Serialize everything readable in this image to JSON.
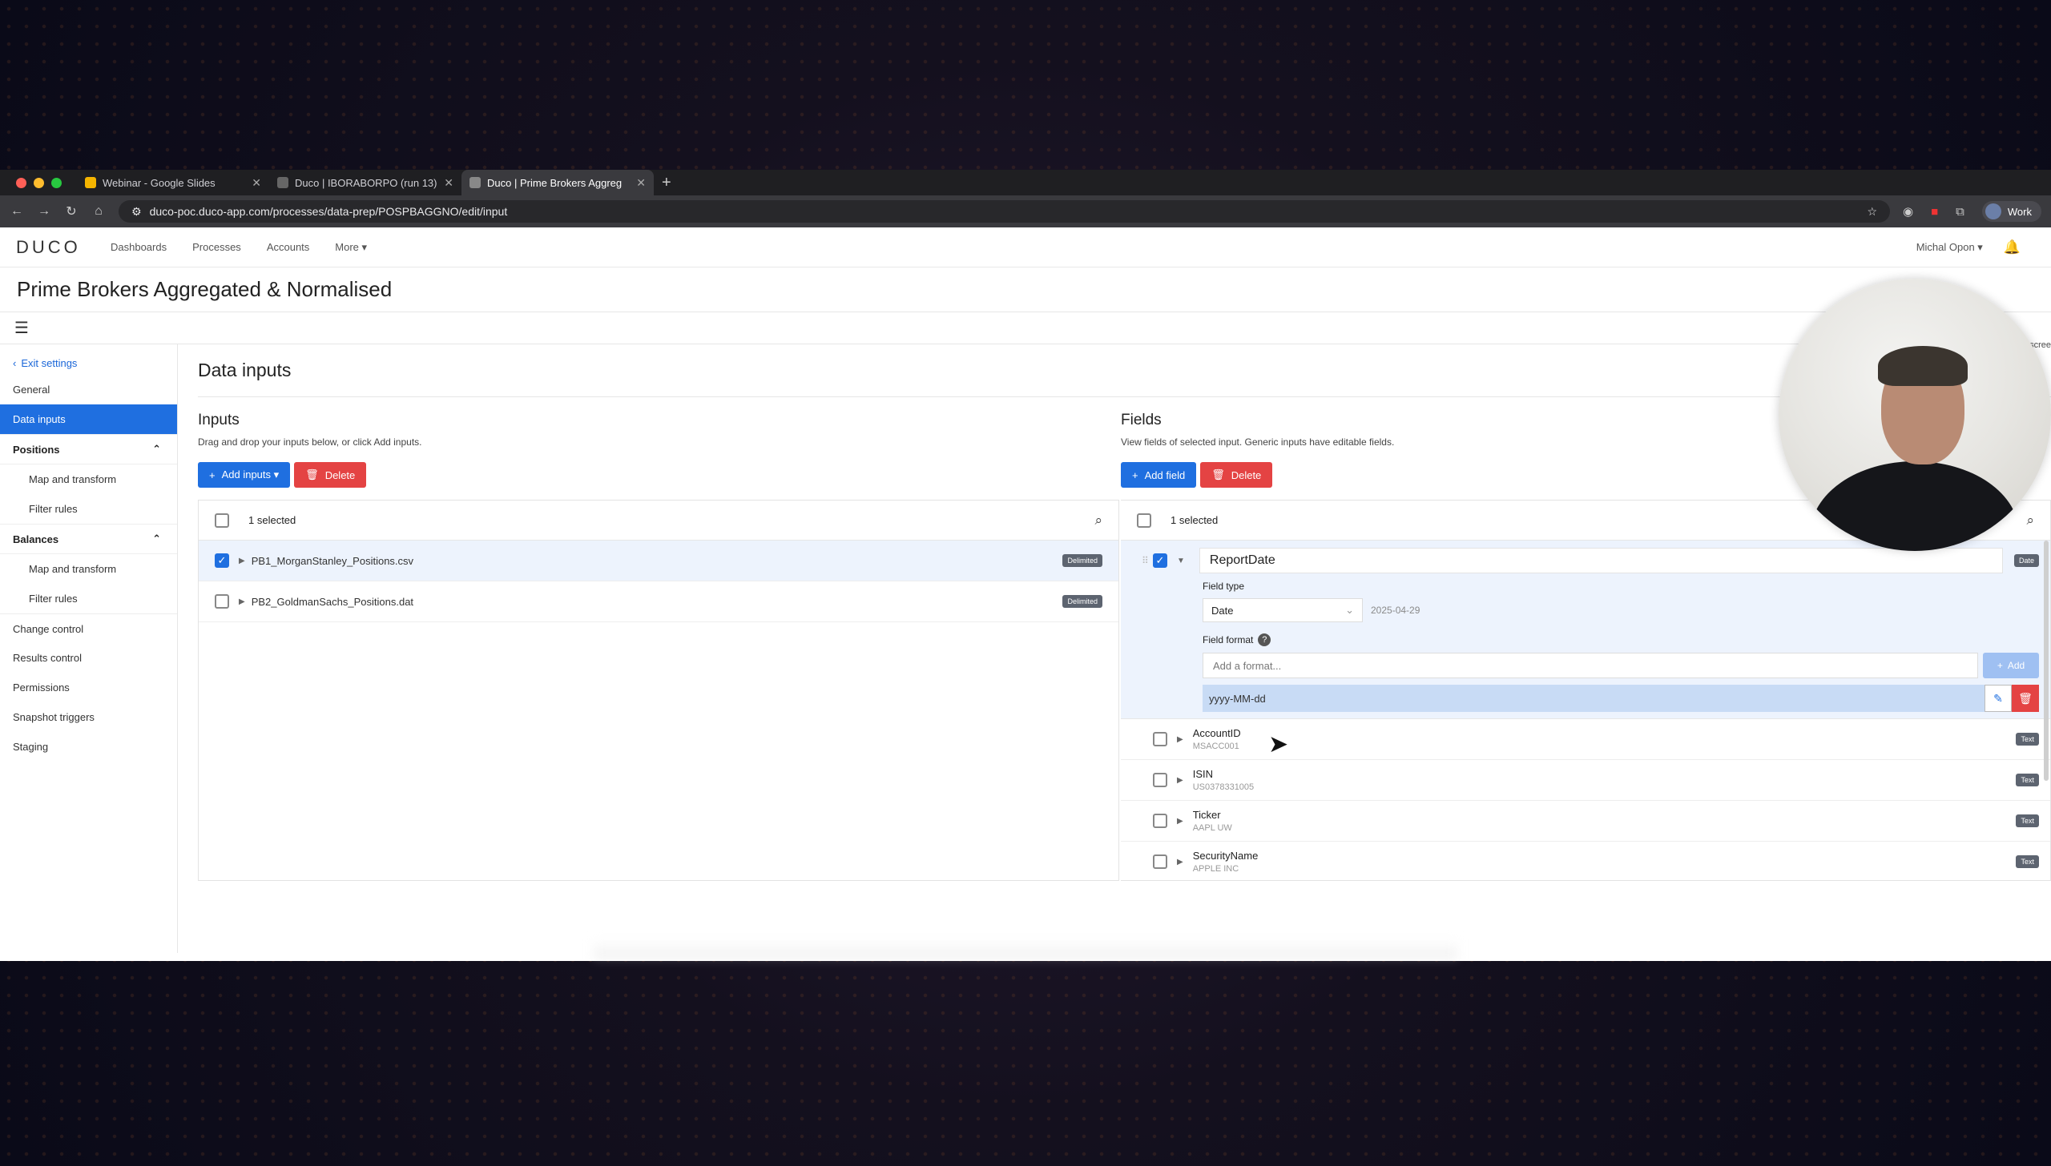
{
  "browser": {
    "tabs": [
      {
        "label": "Webinar - Google Slides",
        "icon_color": "#f4b400"
      },
      {
        "label": "Duco | IBORABORPO (run 13)",
        "icon_color": "#555555"
      },
      {
        "label": "Duco | Prime Brokers Aggreg",
        "icon_color": "#555555"
      }
    ],
    "url": "duco-poc.duco-app.com/processes/data-prep/POSPBAGGNO/edit/input",
    "profile_label": "Work"
  },
  "app": {
    "logo": "DUCO",
    "nav": [
      "Dashboards",
      "Processes",
      "Accounts",
      "More ▾"
    ],
    "user": "Michal Opon ▾",
    "page_title": "Prime Brokers Aggregated & Normalised",
    "edge_text": "scree"
  },
  "sidebar": {
    "exit": "Exit settings",
    "items": {
      "general": "General",
      "data_inputs": "Data inputs",
      "positions": "Positions",
      "positions_map": "Map and transform",
      "positions_filter": "Filter rules",
      "balances": "Balances",
      "balances_map": "Map and transform",
      "balances_filter": "Filter rules",
      "change_control": "Change control",
      "results_control": "Results control",
      "permissions": "Permissions",
      "snapshot_triggers": "Snapshot triggers",
      "staging": "Staging"
    }
  },
  "main": {
    "title": "Data inputs",
    "inputs": {
      "title": "Inputs",
      "desc": "Drag and drop your inputs below, or click Add inputs.",
      "add_label": "Add inputs ▾",
      "delete_label": "Delete",
      "selected_text": "1 selected",
      "rows": [
        {
          "name": "PB1_MorganStanley_Positions.csv",
          "badge": "Delimited"
        },
        {
          "name": "PB2_GoldmanSachs_Positions.dat",
          "badge": "Delimited"
        }
      ]
    },
    "fields": {
      "title": "Fields",
      "desc": "View fields of selected input. Generic inputs have editable fields.",
      "add_label": "Add field",
      "delete_label": "Delete",
      "selected_text": "1 selected",
      "expanded": {
        "name": "ReportDate",
        "badge": "Date",
        "field_type_label": "Field type",
        "field_type_value": "Date",
        "sample": "2025-04-29",
        "field_format_label": "Field format",
        "format_placeholder": "Add a format...",
        "add_label": "Add",
        "format_value": "yyyy-MM-dd"
      },
      "rows": [
        {
          "name": "AccountID",
          "sample": "MSACC001",
          "badge": "Text"
        },
        {
          "name": "ISIN",
          "sample": "US0378331005",
          "badge": "Text"
        },
        {
          "name": "Ticker",
          "sample": "AAPL UW",
          "badge": "Text"
        },
        {
          "name": "SecurityName",
          "sample": "APPLE INC",
          "badge": "Text"
        }
      ]
    }
  }
}
